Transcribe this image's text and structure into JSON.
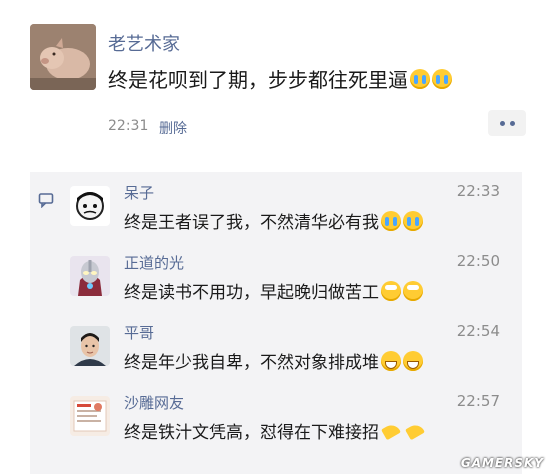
{
  "post": {
    "author": "老艺术家",
    "text": "终是花呗到了期，步步都往死里逼",
    "emojis": [
      "cry-face-emoji",
      "cry-face-emoji"
    ],
    "time": "22:31",
    "delete_label": "删除"
  },
  "comments": [
    {
      "name": "呆子",
      "time": "22:33",
      "text": "终是王者误了我，不然清华必有我",
      "emojis": [
        "laugh-cry-emoji",
        "laugh-cry-emoji"
      ]
    },
    {
      "name": "正道的光",
      "time": "22:50",
      "text": "终是读书不用功，早起晚归做苦工",
      "emojis": [
        "eye-roll-emoji",
        "eye-roll-emoji"
      ]
    },
    {
      "name": "平哥",
      "time": "22:54",
      "text": "终是年少我自卑，不然对象排成堆",
      "emojis": [
        "grin-emoji",
        "grin-emoji"
      ]
    },
    {
      "name": "沙雕网友",
      "time": "22:57",
      "text": "终是铁汁文凭高，怼得在下难接招",
      "emojis": [
        "clap-hands-emoji",
        "clap-hands-emoji"
      ]
    }
  ],
  "watermark": "GAMERSKY"
}
